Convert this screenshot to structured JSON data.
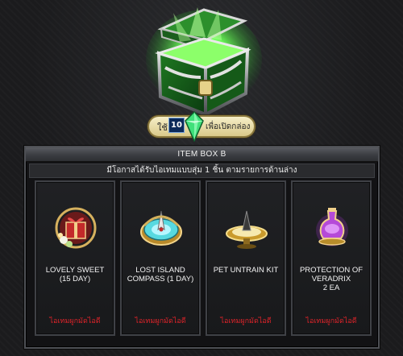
{
  "chest": {
    "icon": "green-treasure-chest-icon"
  },
  "cost": {
    "prefix": "ใช้",
    "amount": "10",
    "gem_icon": "green-crystal-icon",
    "suffix": "เพื่อเปิดกล่อง"
  },
  "panel": {
    "title": "ITEM BOX B",
    "description": "มีโอกาสได้รับไอเทมแบบสุ่ม 1 ชิ้น ตามรายการด้านล่าง"
  },
  "items": [
    {
      "name": "LOVELY SWEET\n(15 DAY)",
      "tag": "ไอเทมผูกมัดไอดี",
      "icon": "gift-box-heart-icon"
    },
    {
      "name": "LOST ISLAND\nCOMPASS (1 DAY)",
      "tag": "ไอเทมผูกมัดไอดี",
      "icon": "compass-icon"
    },
    {
      "name": "PET UNTRAIN KIT",
      "tag": "ไอเทมผูกมัดไอดี",
      "icon": "pet-kit-icon"
    },
    {
      "name": "PROTECTION OF\nVERADRIX\n2 EA",
      "tag": "ไอเทมผูกมัดไอดี",
      "icon": "potion-bottle-icon"
    }
  ],
  "colors": {
    "tag": "#e0242a",
    "gem": "#3fe07a",
    "panel_border": "#4d4f54"
  }
}
